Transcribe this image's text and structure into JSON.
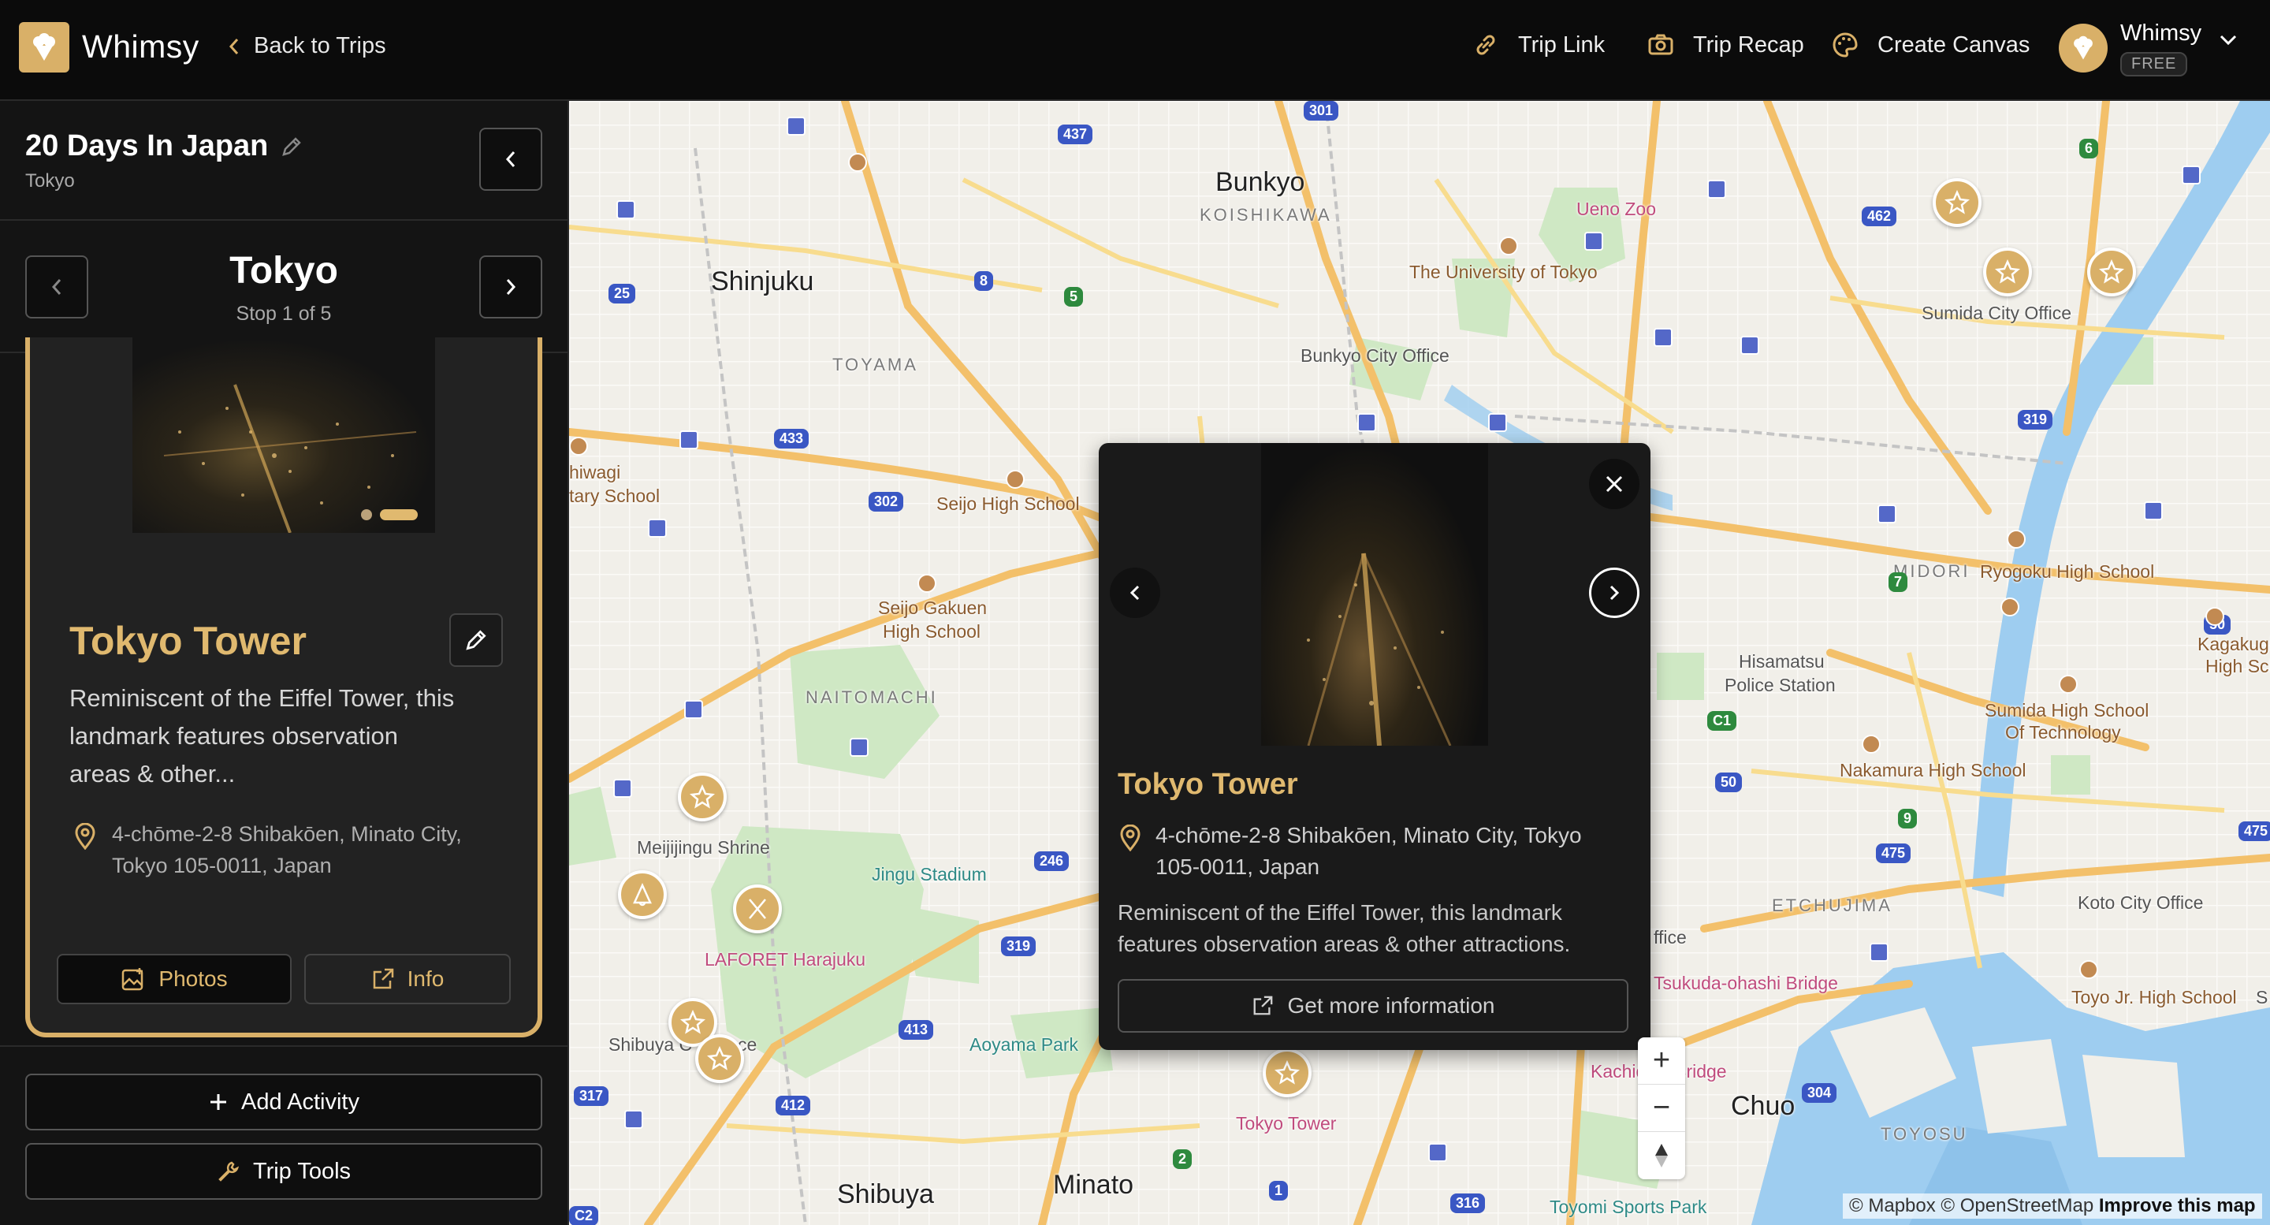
{
  "app": {
    "brand": "Whimsy",
    "back_label": "Back to Trips"
  },
  "topbar": {
    "trip_link": "Trip Link",
    "trip_recap": "Trip Recap",
    "create_canvas": "Create Canvas",
    "user_name": "Whimsy",
    "user_plan": "FREE"
  },
  "trip": {
    "title": "20 Days In Japan",
    "subtitle": "Tokyo"
  },
  "stop": {
    "title": "Tokyo",
    "subtitle": "Stop 1 of 5"
  },
  "card": {
    "title": "Tokyo Tower",
    "description": "Reminiscent of the Eiffel Tower, this landmark features observation areas & other...",
    "address": "4-chōme-2-8 Shibakōen, Minato City, Tokyo 105-0011, Japan",
    "photos_label": "Photos",
    "info_label": "Info"
  },
  "sidebar_actions": {
    "add_activity": "Add Activity",
    "trip_tools": "Trip Tools"
  },
  "popup": {
    "title": "Tokyo Tower",
    "address": "4-chōme-2-8 Shibakōen, Minato City, Tokyo 105-0011, Japan",
    "description": "Reminiscent of the Eiffel Tower, this landmark features observation areas & other attractions.",
    "button": "Get more information"
  },
  "map": {
    "labels": {
      "bunkyo": "Bunkyo",
      "koishikawa": "KOISHIKAWA",
      "shinjuku": "Shinjuku",
      "ueno_zoo": "Ueno Zoo",
      "univ_tokyo": "The University of Tokyo",
      "bunkyo_office": "Bunkyo City Office",
      "sumida_office": "Sumida City Office",
      "toyama": "TOYAMA",
      "seijo_high": "Seijo High School",
      "seijo_gakuen": "Seijo Gakuen",
      "high_school": "High School",
      "naitomachi": "NAITOMACHI",
      "meiji": "Meijijingu Shrine",
      "jingu": "Jingu Stadium",
      "laforet": "LAFORET Harajuku",
      "aoyama": "Aoyama Park",
      "shibuya_ce": "Shibuya C",
      "shibuya_ce2": "ce",
      "shibuya": "Shibuya",
      "minato": "Minato",
      "tokyo_tower": "Tokyo Tower",
      "midori": "MIDORI",
      "ryogoku": "Ryogoku High School",
      "hisamatsu": "Hisamatsu",
      "police": "Police Station",
      "sumida_high": "Sumida High School",
      "of_tech": "Of Technology",
      "nakamura": "Nakamura High School",
      "etchujima": "ETCHUJIMA",
      "koto_office": "Koto City Office",
      "tsukuda": "Tsukuda-ohashi Bridge",
      "kachidoki": "Kachidoki Bridge",
      "chuo": "Chuo",
      "toyosu": "TOYOSU",
      "toyojr": "Toyo Jr. High School",
      "toyomi": "Toyomi Sports Park",
      "kagakuin": "Kagakugi",
      "high_sch": "High Sch",
      "hiwagi": "hiwagi",
      "tary": "tary School",
      "ffice": "ffice",
      "s_edge": "S"
    },
    "shields": [
      "301",
      "437",
      "462",
      "6",
      "8",
      "5",
      "25",
      "433",
      "302",
      "319",
      "7",
      "50",
      "C1",
      "9",
      "475",
      "246",
      "319",
      "413",
      "412",
      "317",
      "304",
      "50",
      "2",
      "1",
      "316",
      "C2",
      "50",
      "475"
    ],
    "attribution_a": "© Mapbox © OpenStreetMap",
    "attribution_b": "Improve this map",
    "zoom_in": "+",
    "zoom_out": "−"
  },
  "colors": {
    "accent": "#d9b068",
    "background": "#141414"
  }
}
